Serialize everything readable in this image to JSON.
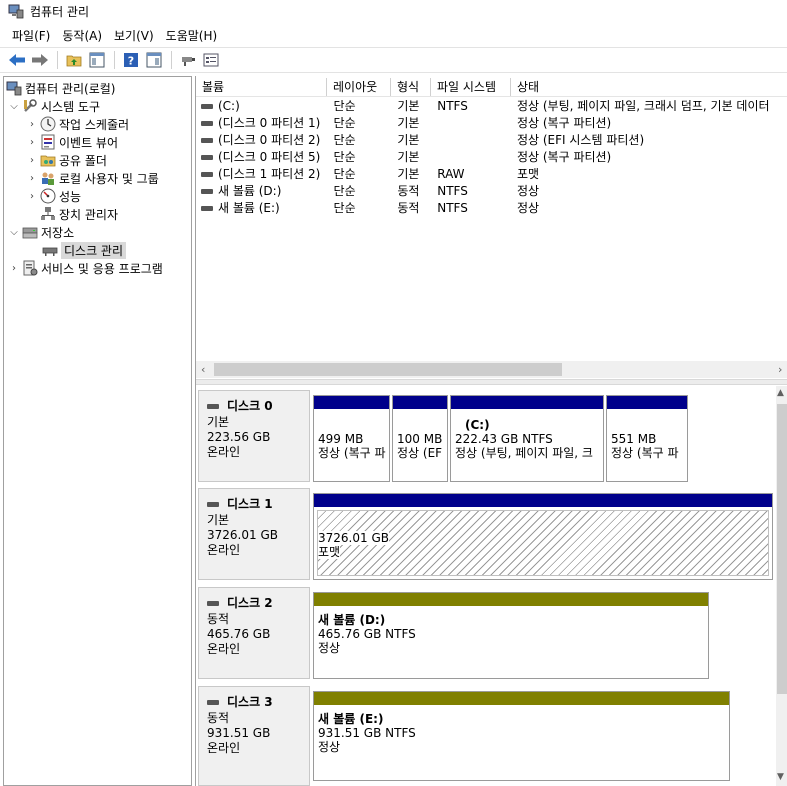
{
  "window": {
    "title": "컴퓨터 관리"
  },
  "menu": [
    "파일(F)",
    "동작(A)",
    "보기(V)",
    "도움말(H)"
  ],
  "toolbar_icons": [
    "back-arrow-icon",
    "forward-arrow-icon",
    "up-folder-icon",
    "show-hide-tree-icon",
    "help-icon",
    "action-pane-icon",
    "connect-icon",
    "properties-icon"
  ],
  "tree": {
    "root": "컴퓨터 관리(로컬)",
    "system_tools": "시스템 도구",
    "task_scheduler": "작업 스케줄러",
    "event_viewer": "이벤트 뷰어",
    "shared_folders": "공유 폴더",
    "local_users": "로컬 사용자 및 그룹",
    "performance": "성능",
    "device_manager": "장치 관리자",
    "storage": "저장소",
    "disk_management": "디스크 관리",
    "services": "서비스 및 응용 프로그램"
  },
  "volume_list": {
    "headers": [
      "볼륨",
      "레이아웃",
      "형식",
      "파일 시스템",
      "상태"
    ],
    "rows": [
      {
        "volume": "(C:)",
        "layout": "단순",
        "type": "기본",
        "fs": "NTFS",
        "status": "정상 (부팅, 페이지 파일, 크래시 덤프, 기본 데이터"
      },
      {
        "volume": "(디스크 0 파티션 1)",
        "layout": "단순",
        "type": "기본",
        "fs": "",
        "status": "정상 (복구 파티션)"
      },
      {
        "volume": "(디스크 0 파티션 2)",
        "layout": "단순",
        "type": "기본",
        "fs": "",
        "status": "정상 (EFI 시스템 파티션)"
      },
      {
        "volume": "(디스크 0 파티션 5)",
        "layout": "단순",
        "type": "기본",
        "fs": "",
        "status": "정상 (복구 파티션)"
      },
      {
        "volume": "(디스크 1 파티션 2)",
        "layout": "단순",
        "type": "기본",
        "fs": "RAW",
        "status": "포맷"
      },
      {
        "volume": "새 볼륨 (D:)",
        "layout": "단순",
        "type": "동적",
        "fs": "NTFS",
        "status": "정상"
      },
      {
        "volume": "새 볼륨 (E:)",
        "layout": "단순",
        "type": "동적",
        "fs": "NTFS",
        "status": "정상"
      }
    ]
  },
  "disks": [
    {
      "name": "디스크 0",
      "kind": "기본",
      "size": "223.56 GB",
      "state": "온라인",
      "partitions": [
        {
          "title": "",
          "line1": "499 MB",
          "line2": "정상 (복구 파"
        },
        {
          "title": "",
          "line1": "100 MB",
          "line2": "정상 (EF"
        },
        {
          "title": "(C:)",
          "line1": "222.43 GB NTFS",
          "line2": "정상 (부팅, 페이지 파일, 크"
        },
        {
          "title": "",
          "line1": "551 MB",
          "line2": "정상 (복구 파"
        }
      ]
    },
    {
      "name": "디스크 1",
      "kind": "기본",
      "size": "3726.01 GB",
      "state": "온라인",
      "partitions": [
        {
          "title": "",
          "line1": "3726.01 GB",
          "line2": "포맷"
        }
      ]
    },
    {
      "name": "디스크 2",
      "kind": "동적",
      "size": "465.76 GB",
      "state": "온라인",
      "partitions": [
        {
          "title": "새 볼륨  (D:)",
          "line1": "465.76 GB NTFS",
          "line2": "정상"
        }
      ]
    },
    {
      "name": "디스크 3",
      "kind": "동적",
      "size": "931.51 GB",
      "state": "온라인",
      "partitions": [
        {
          "title": "새 볼륨  (E:)",
          "line1": "931.51 GB NTFS",
          "line2": "정상"
        }
      ]
    }
  ],
  "colors": {
    "basic_bar": "#00008b",
    "dynamic_bar": "#808000",
    "selection": "#d9d9d9"
  }
}
